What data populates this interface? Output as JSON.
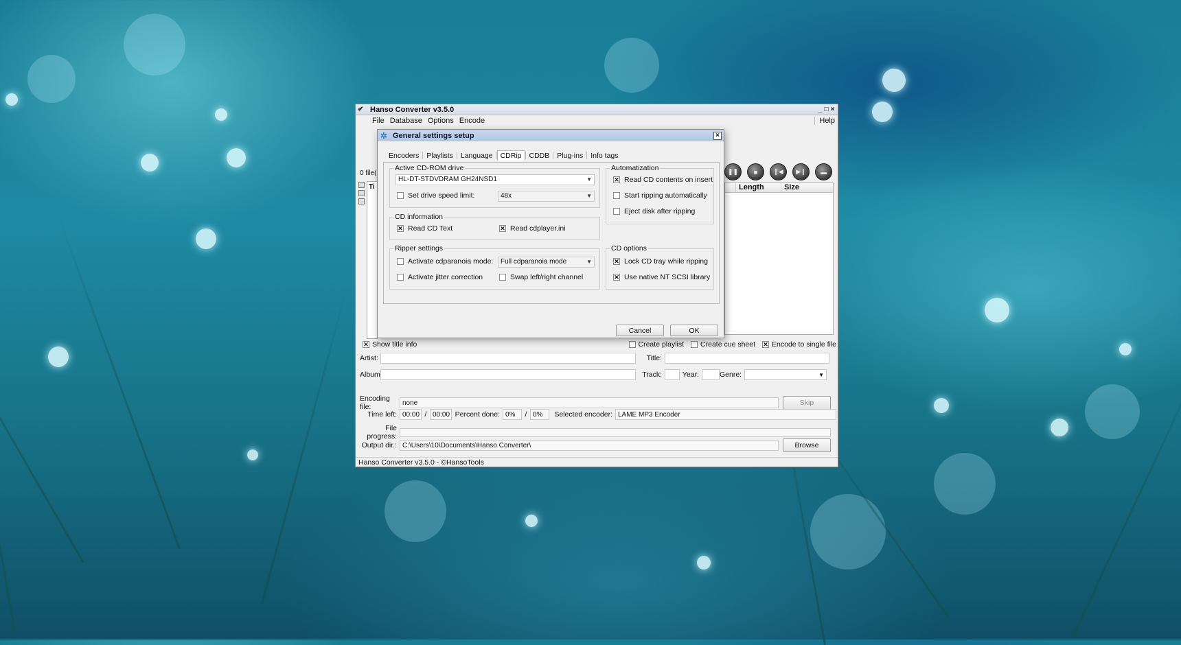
{
  "main_window": {
    "title": "Hanso Converter v3.5.0",
    "controls": [
      "_",
      "□",
      "×"
    ],
    "menu": [
      "File",
      "Database",
      "Options",
      "Encode"
    ],
    "help": "Help",
    "file_count": "0 file(",
    "left_list_header": "Ti",
    "track_columns": [
      "Length",
      "Size"
    ],
    "options_row": {
      "show_title_info": "Show title info",
      "create_playlist": "Create playlist",
      "create_cue_sheet": "Create cue sheet",
      "encode_single_file": "Encode to single file"
    },
    "fields": {
      "artist_label": "Artist:",
      "title_label": "Title:",
      "album_label": "Album:",
      "track_label": "Track:",
      "year_label": "Year:",
      "genre_label": "Genre:"
    },
    "encoding": {
      "encoding_file_label": "Encoding file:",
      "encoding_file_value": "none",
      "skip": "Skip",
      "time_left_label": "Time left:",
      "time_left_value": "00:00",
      "time_sep": "/",
      "time_total": "00:00",
      "percent_label": "Percent done:",
      "percent_value": "0%",
      "percent_total": "0%",
      "selected_encoder_label": "Selected encoder:",
      "selected_encoder_value": "LAME MP3 Encoder",
      "file_progress_label": "File progress:",
      "output_dir_label": "Output dir.:",
      "output_dir_value": "C:\\Users\\10\\Documents\\Hanso Converter\\",
      "browse": "Browse"
    },
    "status_bar": "Hanso Converter v3.5.0 - ©HansoTools"
  },
  "dialog": {
    "title": "General settings setup",
    "close": "×",
    "tabs": [
      "Encoders",
      "Playlists",
      "Language",
      "CDRip",
      "CDDB",
      "Plug-ins",
      "Info tags"
    ],
    "active_tab": "CDRip",
    "active_drive": {
      "group": "Active CD-ROM drive",
      "drive": "HL-DT-STDVDRAM GH24NSD1",
      "speed_limit_label": "Set drive speed limit:",
      "speed_value": "48x"
    },
    "automatization": {
      "group": "Automatization",
      "read_on_insert": "Read CD contents on insert",
      "start_ripping": "Start ripping automatically",
      "eject_after": "Eject disk after ripping"
    },
    "cd_information": {
      "group": "CD information",
      "read_cd_text": "Read CD Text",
      "read_cdplayer": "Read cdplayer.ini"
    },
    "ripper_settings": {
      "group": "Ripper settings",
      "cdparanoia_label": "Activate cdparanoia mode:",
      "cdparanoia_mode": "Full cdparanoia mode",
      "jitter": "Activate jitter correction",
      "swap_channels": "Swap left/right channel"
    },
    "cd_options": {
      "group": "CD options",
      "lock_tray": "Lock CD tray while ripping",
      "native_scsi": "Use native NT SCSI library"
    },
    "cancel": "Cancel",
    "ok": "OK"
  },
  "check_mark": "✕"
}
